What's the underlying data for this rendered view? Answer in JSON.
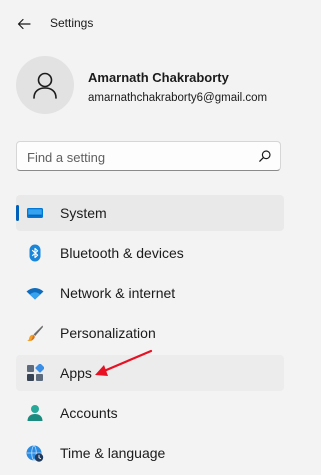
{
  "app": {
    "title": "Settings"
  },
  "profile": {
    "name": "Amarnath Chakraborty",
    "email": "amarnathchakraborty6@gmail.com"
  },
  "search": {
    "placeholder": "Find a setting"
  },
  "nav": {
    "items": [
      {
        "label": "System",
        "icon": "system-icon",
        "selected": true
      },
      {
        "label": "Bluetooth & devices",
        "icon": "bluetooth-icon"
      },
      {
        "label": "Network & internet",
        "icon": "wifi-icon"
      },
      {
        "label": "Personalization",
        "icon": "brush-icon"
      },
      {
        "label": "Apps",
        "icon": "apps-icon",
        "hover": true
      },
      {
        "label": "Accounts",
        "icon": "accounts-icon"
      },
      {
        "label": "Time & language",
        "icon": "globe-clock-icon"
      }
    ]
  },
  "colors": {
    "accent": "#005fb8",
    "annotation_arrow": "#e81123"
  }
}
